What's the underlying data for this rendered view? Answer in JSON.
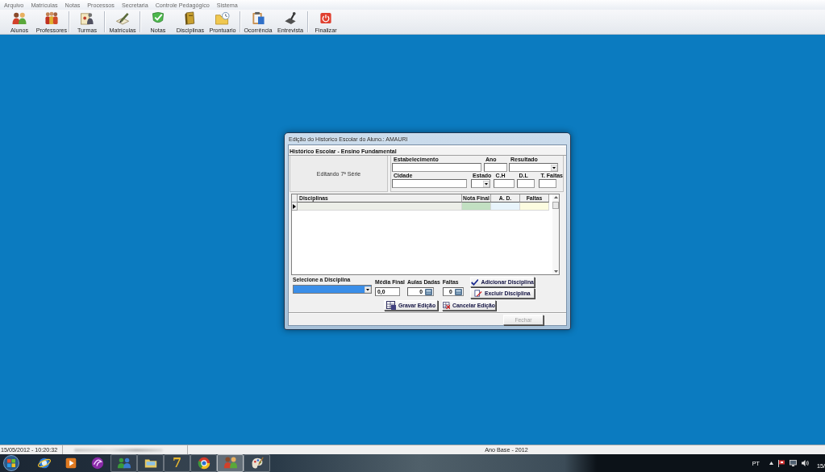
{
  "menu": [
    "Arquivo",
    "Matrículas",
    "Notas",
    "Processos",
    "Secretaria",
    "Controle Pedagógico",
    "Sistema"
  ],
  "toolbar": {
    "groups": [
      [
        {
          "label": "Alunos"
        },
        {
          "label": "Professores"
        }
      ],
      [
        {
          "label": "Turmas"
        }
      ],
      [
        {
          "label": "Matrículas"
        }
      ],
      [
        {
          "label": "Notas"
        },
        {
          "label": "Disciplinas"
        },
        {
          "label": "Prontuario"
        }
      ],
      [
        {
          "label": "Ocorrência"
        },
        {
          "label": "Entrevista"
        }
      ],
      [
        {
          "label": "Finalizar"
        }
      ]
    ]
  },
  "dialog": {
    "title": "Edição do Historico Escolar do Aluno.: AMAURI",
    "section_title": "Histórico Escolar - Ensino Fundamental",
    "editing_label": "Editando 7ª Série",
    "fields": [
      [
        {
          "label": "Estabelecimento",
          "kind": "text"
        },
        {
          "label": "Ano",
          "kind": "text"
        },
        {
          "label": "Resultado",
          "kind": "select"
        }
      ],
      [
        {
          "label": "Cidade",
          "kind": "text"
        },
        {
          "label": "Estado",
          "kind": "select"
        },
        {
          "label": "C.H",
          "kind": "text"
        },
        {
          "label": "D.L",
          "kind": "text"
        },
        {
          "label": "T. Faltas",
          "kind": "text"
        }
      ]
    ],
    "grid": {
      "columns": [
        {
          "label": "Disciplinas"
        },
        {
          "label": "Nota Final",
          "color": "#c2e0c2"
        },
        {
          "label": "A. D.",
          "color": "#e8f4fb"
        },
        {
          "label": "Faltas",
          "color": "#fcfce0"
        }
      ],
      "rows": [
        {
          "selected": true
        }
      ]
    },
    "discipline_select": {
      "label": "Selecione a Disciplina",
      "focused": true
    },
    "score_fields": [
      {
        "label": "Média Final",
        "value": "0,0",
        "kind": "plain"
      },
      {
        "label": "Aulas Dadas",
        "value": "0",
        "kind": "calc"
      },
      {
        "label": "Faltas",
        "value": "0",
        "kind": "calc"
      }
    ],
    "side_buttons": [
      {
        "label": "Adicionar Disciplina"
      },
      {
        "label": "Excluir Disciplina"
      }
    ],
    "actions": [
      {
        "label": "Gravar Edição"
      },
      {
        "label": "Cancelar Edição"
      }
    ],
    "close_button": {
      "label": "Fechar",
      "disabled": true
    }
  },
  "status_bar": {
    "datetime": "15/05/2012 - 10:20:32",
    "base_year": "Ano Base - 2012"
  },
  "taskbar": {
    "apps": [
      {
        "running": false,
        "selected": false
      },
      {
        "running": false,
        "selected": false
      },
      {
        "running": false,
        "selected": false
      },
      {
        "running": true,
        "selected": false
      },
      {
        "running": true,
        "selected": false
      },
      {
        "running": true,
        "selected": false,
        "glyph": "7"
      },
      {
        "running": true,
        "selected": false
      },
      {
        "running": true,
        "selected": true
      },
      {
        "running": true,
        "selected": false
      }
    ],
    "language": "PT",
    "clock": "15/"
  }
}
